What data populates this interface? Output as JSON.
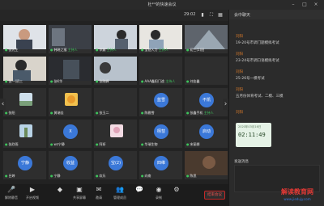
{
  "window": {
    "title": "杜**的快速会议"
  },
  "toolbar": {
    "time": "29:02"
  },
  "participants": [
    {
      "name": "张先生",
      "role": ""
    },
    {
      "name": "韩晓之猴",
      "role": "主持人"
    },
    {
      "name": "李晨",
      "role": "主持人"
    },
    {
      "name": "宝爸入力",
      "role": "主持人"
    },
    {
      "name": "初三(1)班",
      "role": ""
    },
    {
      "name": "张一(初三",
      "role": ""
    },
    {
      "name": "张K华",
      "role": ""
    },
    {
      "name": "张晓峰",
      "role": ""
    },
    {
      "name": "AAA鑫阳门途",
      "role": "主持人"
    },
    {
      "name": "刘金鑫",
      "role": ""
    },
    {
      "name": "张阳",
      "role": ""
    },
    {
      "name": "黄瑞佳",
      "role": ""
    },
    {
      "name": "张玉二",
      "role": ""
    },
    {
      "name": "陈雅雪",
      "role": ""
    },
    {
      "name": "张鑫手机",
      "role": "主持人"
    },
    {
      "name": "张欣雨",
      "role": ""
    },
    {
      "name": "wz宁静",
      "role": ""
    },
    {
      "name": "阿妍",
      "role": ""
    },
    {
      "name": "华瑞生物",
      "role": ""
    },
    {
      "name": "宋丽娜",
      "role": ""
    },
    {
      "name": "吕婷",
      "role": ""
    },
    {
      "name": "宁静",
      "role": ""
    },
    {
      "name": "欢乐",
      "role": ""
    },
    {
      "name": "向南",
      "role": ""
    },
    {
      "name": "陈思",
      "role": ""
    }
  ],
  "avatars": {
    "a1": "X",
    "a2": "蓝雪",
    "a3": "不凯",
    "a4": "栩彗",
    "a5": "启动",
    "a6": "宁静",
    "a7": "收益",
    "a8": "宝(2)",
    "a9": "四维"
  },
  "chat": {
    "title": "会中聊天",
    "messages": [
      {
        "sender": "刘阳",
        "text": "19-20号市调门题模拟考试"
      },
      {
        "sender": "刘阳",
        "text": "23-24号市调口语模拟考试"
      },
      {
        "sender": "刘阳",
        "text": "25-26号一模考试"
      },
      {
        "sender": "刘阳",
        "text": "五月份体育考试、二模、三模"
      },
      {
        "sender": "刘阳",
        "text": ""
      }
    ],
    "timecard_date": "2020年03月16日",
    "timecard_time": "02:11:49",
    "input_label": "发送消息"
  },
  "bottom": {
    "mic": "解除静音",
    "camera": "开启视频",
    "security": "",
    "members": "",
    "share": "共享屏幕",
    "invite": "邀请",
    "manage": "管理成员",
    "chat": "",
    "record": "录制",
    "more": "",
    "end": "结束会议"
  },
  "watermark": {
    "text": "解读教育网",
    "url": "www.jiedujy.com"
  },
  "colors": {
    "accent": "#3ec45c",
    "chat_sender": "#d97a2b",
    "end": "#e53935"
  }
}
